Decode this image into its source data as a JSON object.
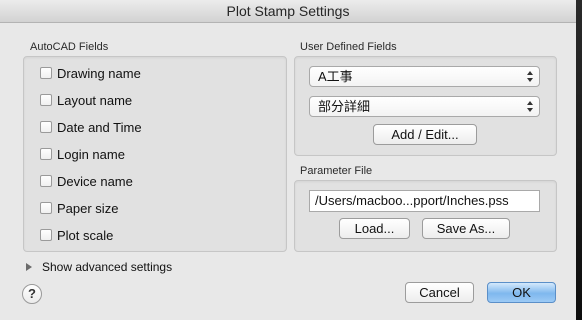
{
  "window": {
    "title": "Plot Stamp Settings"
  },
  "autocad_fields": {
    "label": "AutoCAD Fields",
    "items": [
      {
        "label": "Drawing name",
        "checked": false
      },
      {
        "label": "Layout name",
        "checked": false
      },
      {
        "label": "Date and Time",
        "checked": false
      },
      {
        "label": "Login name",
        "checked": false
      },
      {
        "label": "Device name",
        "checked": false
      },
      {
        "label": "Paper size",
        "checked": false
      },
      {
        "label": "Plot scale",
        "checked": false
      }
    ]
  },
  "user_defined_fields": {
    "label": "User Defined Fields",
    "popup1_value": "A工事",
    "popup2_value": "部分詳細",
    "add_edit_label": "Add / Edit..."
  },
  "parameter_file": {
    "label": "Parameter File",
    "path_value": "/Users/macboo...pport/Inches.pss",
    "load_label": "Load...",
    "save_as_label": "Save As..."
  },
  "advanced": {
    "label": "Show advanced settings"
  },
  "footer": {
    "help_label": "?",
    "cancel_label": "Cancel",
    "ok_label": "OK"
  },
  "icons": {
    "disclosure": "disclosure-triangle-right-icon",
    "popup_arrows": "up-down-arrows-icon",
    "help": "question-mark-icon"
  },
  "colors": {
    "window_bg": "#e8e8e8",
    "group_bg": "#e1e1e1",
    "default_button": "#7fb8ee"
  }
}
